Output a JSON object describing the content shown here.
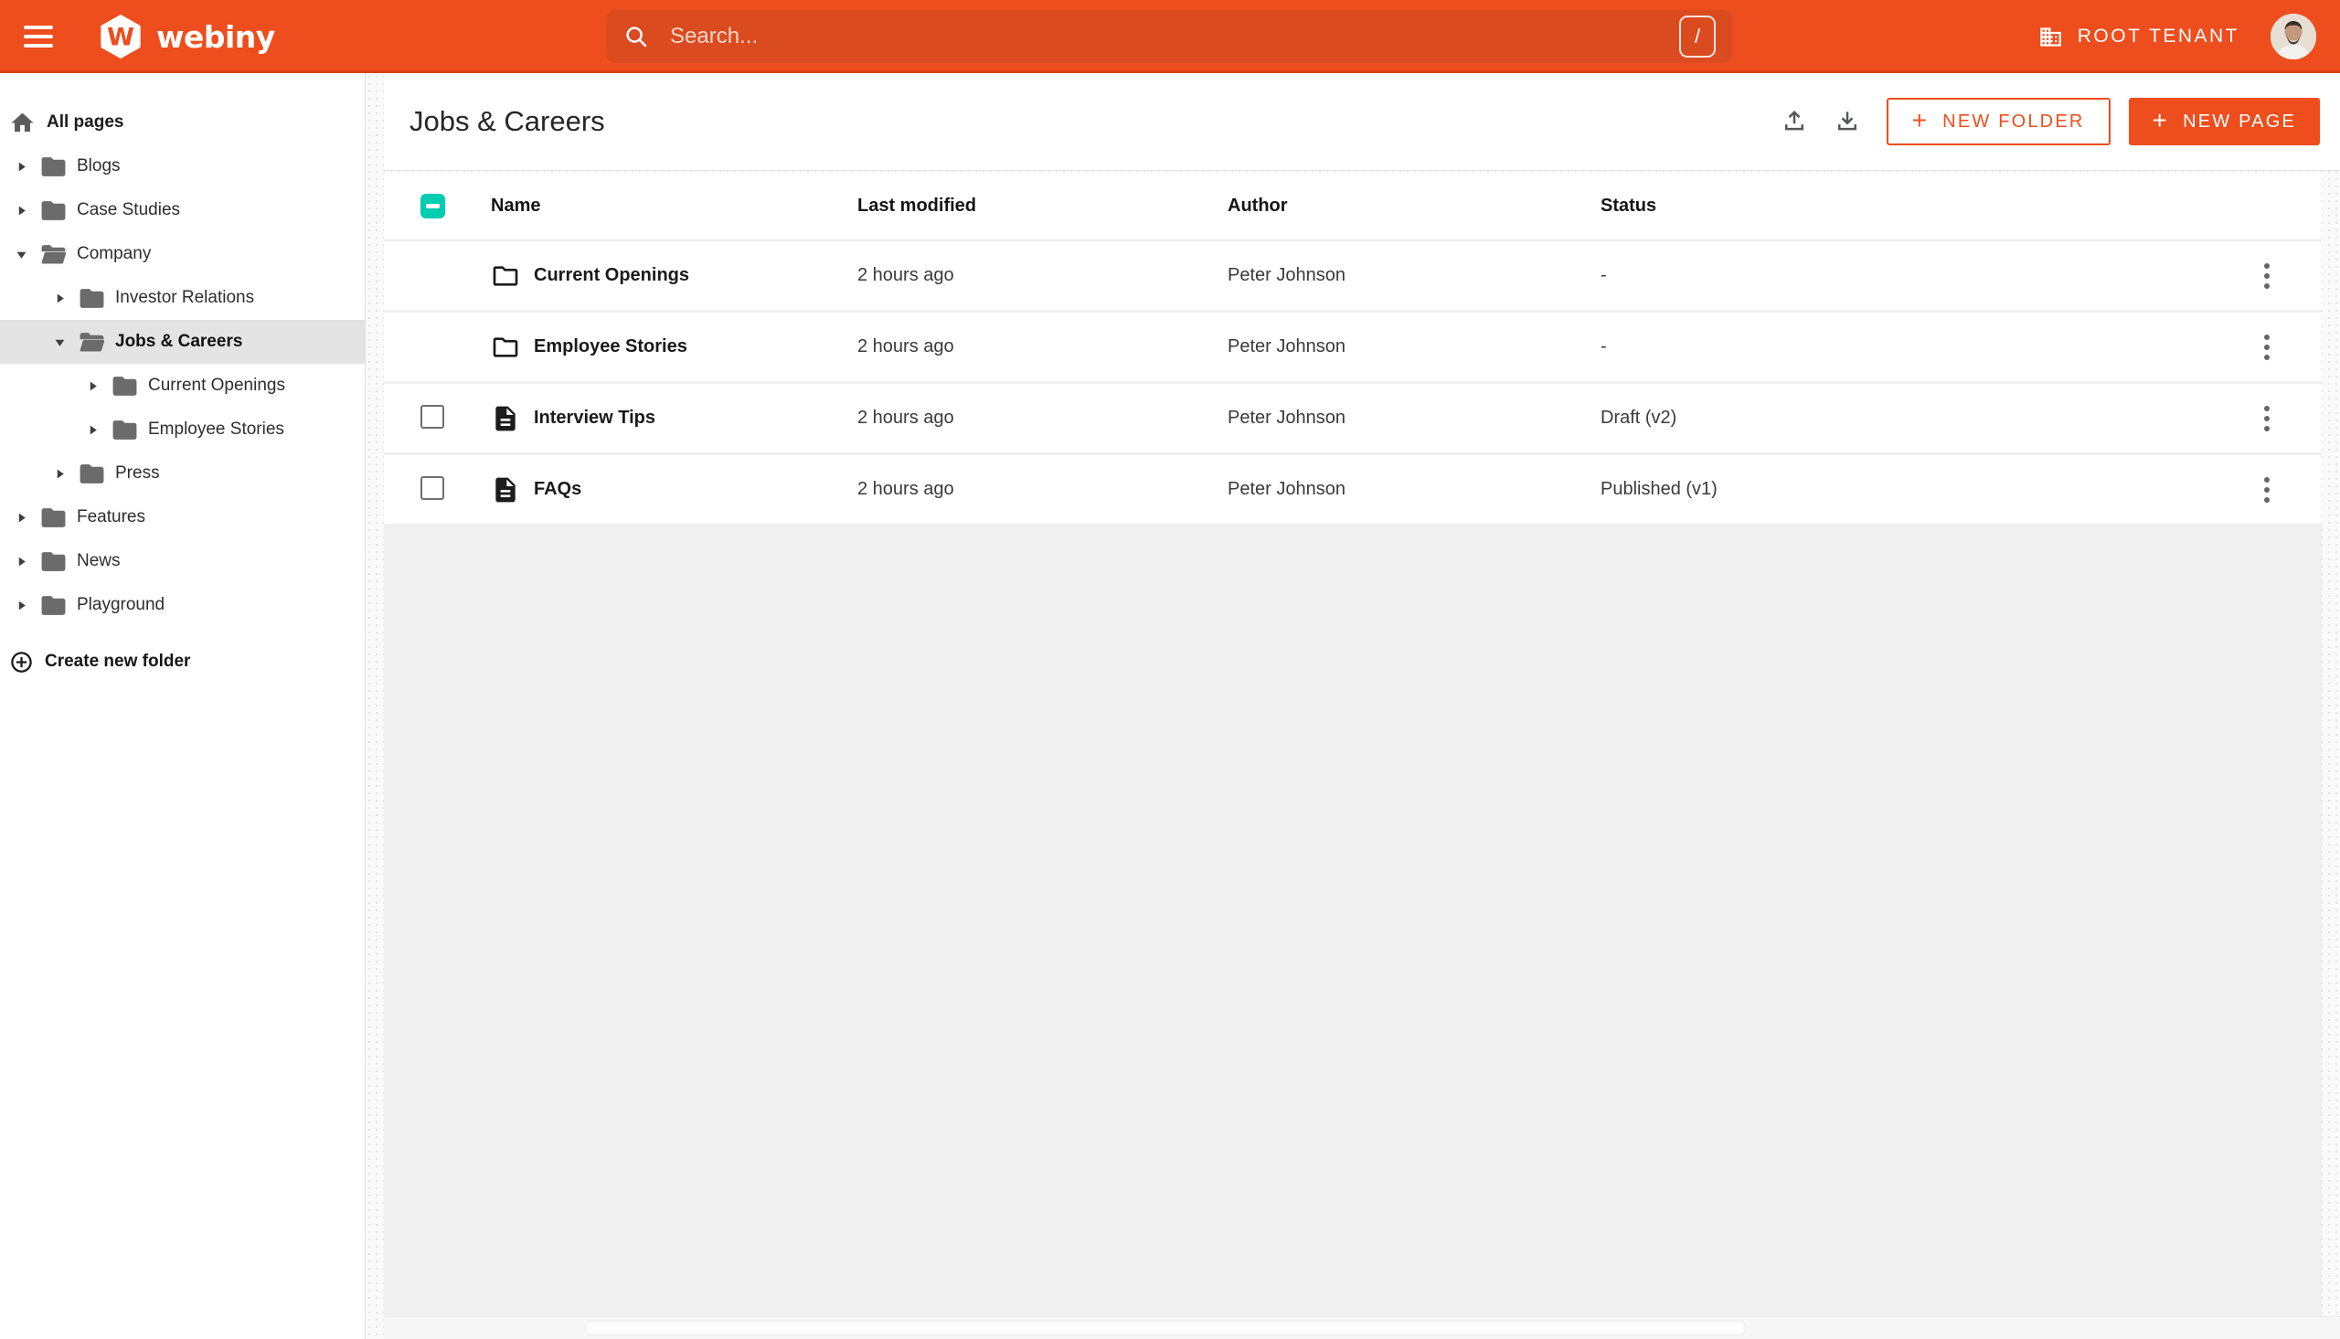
{
  "topbar": {
    "brand": "webiny",
    "search_placeholder": "Search...",
    "shortcut_key": "/",
    "tenant_label": "ROOT TENANT"
  },
  "sidebar": {
    "root_label": "All pages",
    "items": [
      {
        "label": "Blogs",
        "level": 1,
        "state": "collapsed",
        "selected": false
      },
      {
        "label": "Case Studies",
        "level": 1,
        "state": "collapsed",
        "selected": false
      },
      {
        "label": "Company",
        "level": 1,
        "state": "expanded",
        "selected": false
      },
      {
        "label": "Investor Relations",
        "level": 2,
        "state": "collapsed",
        "selected": false
      },
      {
        "label": "Jobs & Careers",
        "level": 2,
        "state": "expanded",
        "selected": true
      },
      {
        "label": "Current Openings",
        "level": 3,
        "state": "collapsed",
        "selected": false
      },
      {
        "label": "Employee Stories",
        "level": 3,
        "state": "collapsed",
        "selected": false
      },
      {
        "label": "Press",
        "level": 2,
        "state": "collapsed",
        "selected": false
      },
      {
        "label": "Features",
        "level": 1,
        "state": "collapsed",
        "selected": false
      },
      {
        "label": "News",
        "level": 1,
        "state": "collapsed",
        "selected": false
      },
      {
        "label": "Playground",
        "level": 1,
        "state": "collapsed",
        "selected": false
      }
    ],
    "create_folder_label": "Create new folder"
  },
  "main": {
    "title": "Jobs & Careers",
    "buttons": {
      "new_folder": "NEW FOLDER",
      "new_page": "NEW PAGE"
    },
    "table": {
      "columns": [
        "Name",
        "Last modified",
        "Author",
        "Status"
      ],
      "rows": [
        {
          "type": "folder",
          "name": "Current Openings",
          "last_modified": "2 hours ago",
          "author": "Peter Johnson",
          "status": "-"
        },
        {
          "type": "folder",
          "name": "Employee Stories",
          "last_modified": "2 hours ago",
          "author": "Peter Johnson",
          "status": "-"
        },
        {
          "type": "page",
          "name": "Interview Tips",
          "last_modified": "2 hours ago",
          "author": "Peter Johnson",
          "status": "Draft (v2)"
        },
        {
          "type": "page",
          "name": "FAQs",
          "last_modified": "2 hours ago",
          "author": "Peter Johnson",
          "status": "Published (v1)"
        }
      ]
    }
  },
  "icons": {
    "topbar": [
      "menu-icon",
      "webiny-logo",
      "search-icon",
      "slash-shortcut-badge",
      "building-icon",
      "avatar"
    ],
    "header": [
      "upload-icon",
      "download-icon",
      "plus-icon"
    ],
    "table": [
      "indeterminate-checkbox",
      "checkbox",
      "folder-icon",
      "page-icon",
      "kebab-menu-icon"
    ],
    "sidebar": [
      "home-icon",
      "folder-closed-icon",
      "folder-open-icon",
      "caret-icon",
      "add-circle-icon"
    ]
  },
  "colors": {
    "accent_orange": "#ee4d1d",
    "search_field_orange": "#db4b20",
    "teal_checkbox": "#00ccb0",
    "selected_row_gray": "#e4e4e4",
    "content_gray": "#f0f0f0"
  }
}
